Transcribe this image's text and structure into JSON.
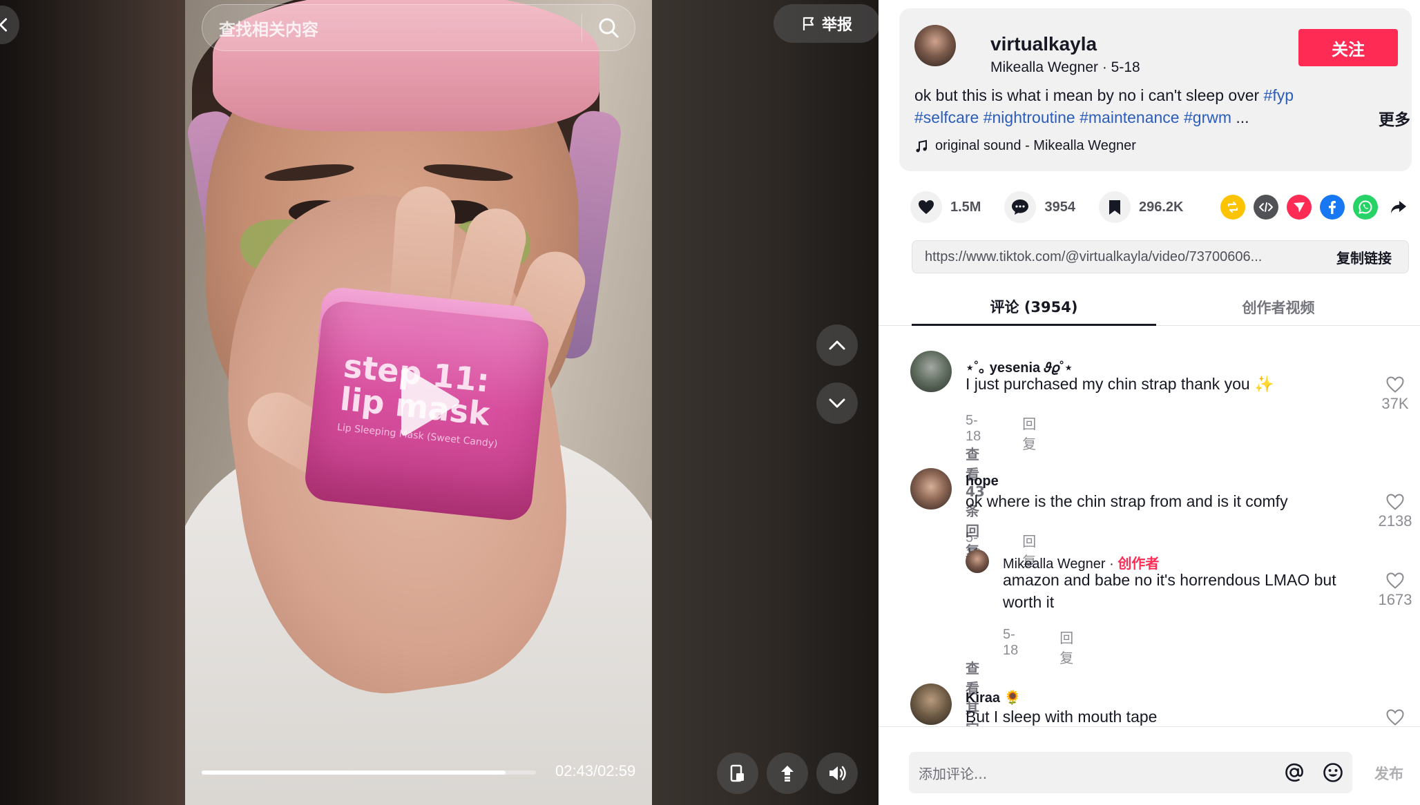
{
  "video": {
    "search_placeholder": "查找相关内容",
    "report_label": "举报",
    "jar_text_big": "step 11:\nlip mask",
    "jar_text_small": "Lip Sleeping Mask (Sweet Candy)",
    "progress": 0.91,
    "time": "02:43/02:59"
  },
  "post": {
    "author_handle": "virtualkayla",
    "author_name_date": "Mikealla Wegner · 5-18",
    "follow_label": "关注",
    "caption_text": "ok but this is what i mean by no i can't sleep over ",
    "caption_tags": [
      "#fyp",
      "#selfcare",
      "#nightroutine",
      "#maintenance",
      "#grwm"
    ],
    "caption_ellipsis": "...",
    "more_label": "更多",
    "sound": "original sound - Mikealla Wegner"
  },
  "stats": {
    "likes": "1.5M",
    "comments": "3954",
    "saves": "296.2K"
  },
  "share_icons": [
    "repost-icon",
    "embed-icon",
    "send-icon",
    "facebook-icon",
    "whatsapp-icon",
    "share-arrow-icon"
  ],
  "link": {
    "url": "https://www.tiktok.com/@virtualkayla/video/73700606...",
    "copy_label": "复制链接"
  },
  "tabs": {
    "comments": "评论 (3954)",
    "creator_videos": "创作者视频"
  },
  "comments": [
    {
      "user": "⋆˚｡ yesenia 𝜗𝜚˚⋆",
      "text": "I just purchased my chin strap thank you ✨",
      "date": "5-18",
      "reply_label": "回复",
      "likes": "37K",
      "view_replies": "查看 43 条回复"
    },
    {
      "user": "hope",
      "text": "ok where is the chin strap from and is it comfy",
      "date": "5-18",
      "reply_label": "回复",
      "likes": "2138",
      "reply": {
        "user": "Mikealla Wegner · ",
        "creator_badge": "创作者",
        "text": "amazon and babe no it's horrendous LMAO but worth it",
        "date": "5-18",
        "reply_label": "回复",
        "likes": "1673"
      },
      "view_more": "查看其它 7 条评论"
    },
    {
      "user": "Kiraa 🌻",
      "text": "But I sleep with mouth tape"
    }
  ],
  "composer": {
    "placeholder": "添加评论...",
    "post_label": "发布"
  },
  "colors": {
    "accent": "#fe2c55",
    "hashtag": "#2b5db9",
    "text": "#161823"
  }
}
